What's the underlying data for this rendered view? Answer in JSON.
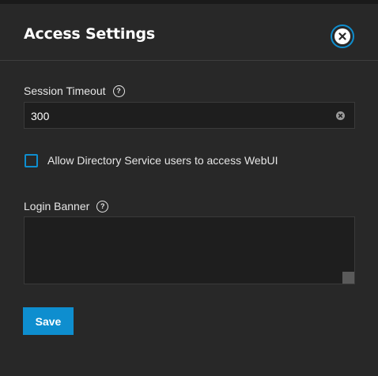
{
  "header": {
    "title": "Access Settings",
    "close_icon": "close-circle-icon"
  },
  "session_timeout": {
    "label": "Session Timeout",
    "help_glyph": "?",
    "value": "300",
    "clear_icon": "clear-input-icon"
  },
  "directory_service": {
    "label": "Allow Directory Service users to access WebUI",
    "checked": false
  },
  "login_banner": {
    "label": "Login Banner",
    "help_glyph": "?",
    "value": ""
  },
  "actions": {
    "save_label": "Save"
  },
  "colors": {
    "background": "#282828",
    "input_background": "#1e1e1e",
    "accent": "#0e8ecf",
    "text": "#e6e6e6"
  }
}
